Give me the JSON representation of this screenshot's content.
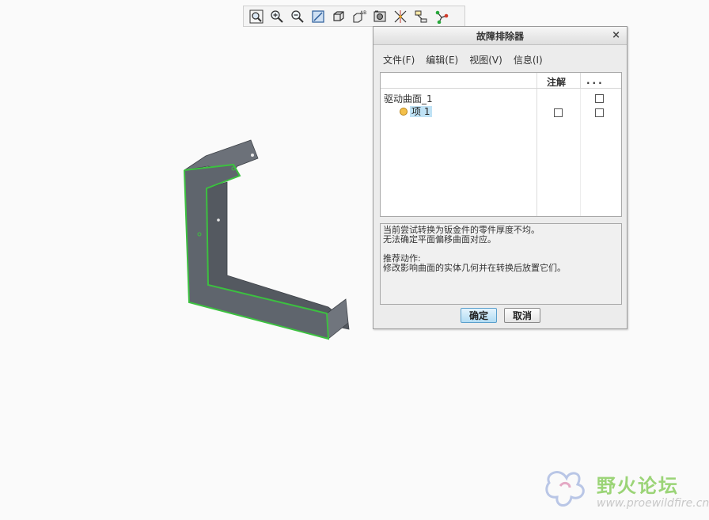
{
  "toolbar": {
    "buttons": [
      {
        "name": "zoom-fit-icon"
      },
      {
        "name": "zoom-in-icon"
      },
      {
        "name": "zoom-out-icon"
      },
      {
        "name": "repaint-icon"
      },
      {
        "name": "display-style-icon"
      },
      {
        "name": "saved-views-icon"
      },
      {
        "name": "view-manager-icon"
      },
      {
        "name": "datum-display-icon"
      },
      {
        "name": "annotation-display-icon"
      },
      {
        "name": "spin-center-icon"
      }
    ]
  },
  "dialog": {
    "title": "故障排除器",
    "close": "×",
    "menu": [
      "文件(F)",
      "编辑(E)",
      "视图(V)",
      "信息(I)"
    ],
    "columns": {
      "note": "注解",
      "more": "..."
    },
    "tree": {
      "parent_label": "驱动曲面_1",
      "child_label": "项 1"
    },
    "message": {
      "line1": "当前尝试转换为钣金件的零件厚度不均。",
      "line2": "无法确定平面偏移曲面对应。",
      "line3": "推荐动作:",
      "line4": "修改影响曲面的实体几何并在转换后放置它们。"
    },
    "ok_label": "确定",
    "cancel_label": "取消"
  },
  "watermark": {
    "title": "野火论坛",
    "url": "www.proewildfire.cn"
  },
  "colors": {
    "model_face": "#5f656d",
    "model_edge_highlight": "#3cc040",
    "selection": "#bfe2f5",
    "watermark_green": "#9bd477"
  }
}
